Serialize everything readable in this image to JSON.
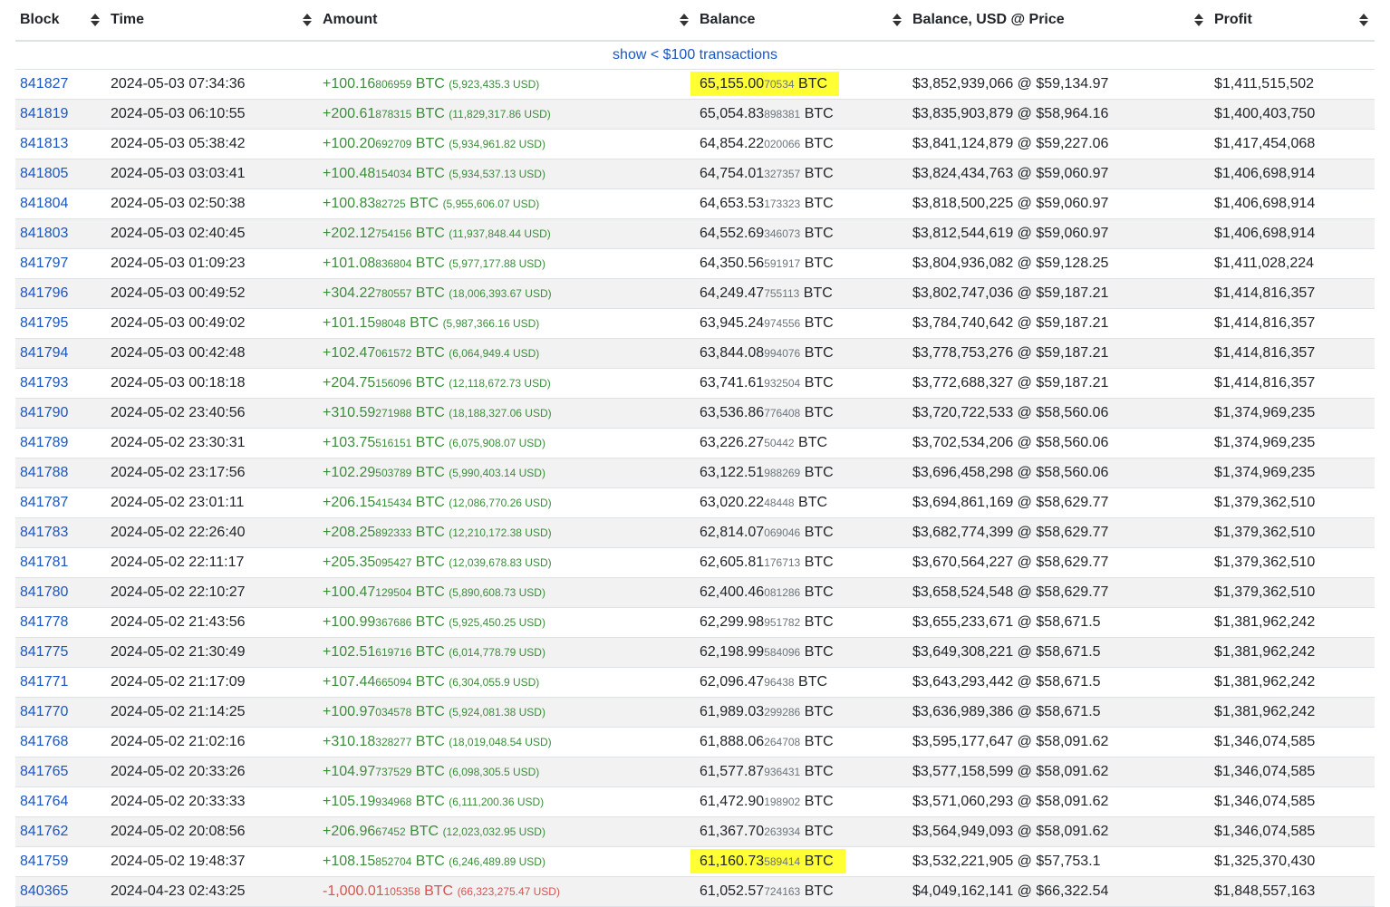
{
  "columns": [
    {
      "key": "block",
      "label": "Block"
    },
    {
      "key": "time",
      "label": "Time"
    },
    {
      "key": "amount",
      "label": "Amount"
    },
    {
      "key": "balance",
      "label": "Balance"
    },
    {
      "key": "usd",
      "label": "Balance, USD @ Price"
    },
    {
      "key": "profit",
      "label": "Profit"
    }
  ],
  "show_small_link": "show < $100 transactions",
  "unit": "BTC",
  "rows": [
    {
      "block": "841827",
      "time": "2024-05-03 07:34:36",
      "amt_main": "+100.16",
      "amt_small": "806959",
      "amt_usd": "(5,923,435.3 USD)",
      "bal_main": "65,155.00",
      "bal_small": "70534",
      "usd": "$3,852,939,066 @ $59,134.97",
      "profit": "$1,411,515,502",
      "type": "pos",
      "highlight": true
    },
    {
      "block": "841819",
      "time": "2024-05-03 06:10:55",
      "amt_main": "+200.61",
      "amt_small": "878315",
      "amt_usd": "(11,829,317.86 USD)",
      "bal_main": "65,054.83",
      "bal_small": "898381",
      "usd": "$3,835,903,879 @ $58,964.16",
      "profit": "$1,400,403,750",
      "type": "pos",
      "highlight": false
    },
    {
      "block": "841813",
      "time": "2024-05-03 05:38:42",
      "amt_main": "+100.20",
      "amt_small": "692709",
      "amt_usd": "(5,934,961.82 USD)",
      "bal_main": "64,854.22",
      "bal_small": "020066",
      "usd": "$3,841,124,879 @ $59,227.06",
      "profit": "$1,417,454,068",
      "type": "pos",
      "highlight": false
    },
    {
      "block": "841805",
      "time": "2024-05-03 03:03:41",
      "amt_main": "+100.48",
      "amt_small": "154034",
      "amt_usd": "(5,934,537.13 USD)",
      "bal_main": "64,754.01",
      "bal_small": "327357",
      "usd": "$3,824,434,763 @ $59,060.97",
      "profit": "$1,406,698,914",
      "type": "pos",
      "highlight": false
    },
    {
      "block": "841804",
      "time": "2024-05-03 02:50:38",
      "amt_main": "+100.83",
      "amt_small": "82725",
      "amt_usd": "(5,955,606.07 USD)",
      "bal_main": "64,653.53",
      "bal_small": "173323",
      "usd": "$3,818,500,225 @ $59,060.97",
      "profit": "$1,406,698,914",
      "type": "pos",
      "highlight": false
    },
    {
      "block": "841803",
      "time": "2024-05-03 02:40:45",
      "amt_main": "+202.12",
      "amt_small": "754156",
      "amt_usd": "(11,937,848.44 USD)",
      "bal_main": "64,552.69",
      "bal_small": "346073",
      "usd": "$3,812,544,619 @ $59,060.97",
      "profit": "$1,406,698,914",
      "type": "pos",
      "highlight": false
    },
    {
      "block": "841797",
      "time": "2024-05-03 01:09:23",
      "amt_main": "+101.08",
      "amt_small": "836804",
      "amt_usd": "(5,977,177.88 USD)",
      "bal_main": "64,350.56",
      "bal_small": "591917",
      "usd": "$3,804,936,082 @ $59,128.25",
      "profit": "$1,411,028,224",
      "type": "pos",
      "highlight": false
    },
    {
      "block": "841796",
      "time": "2024-05-03 00:49:52",
      "amt_main": "+304.22",
      "amt_small": "780557",
      "amt_usd": "(18,006,393.67 USD)",
      "bal_main": "64,249.47",
      "bal_small": "755113",
      "usd": "$3,802,747,036 @ $59,187.21",
      "profit": "$1,414,816,357",
      "type": "pos",
      "highlight": false
    },
    {
      "block": "841795",
      "time": "2024-05-03 00:49:02",
      "amt_main": "+101.15",
      "amt_small": "98048",
      "amt_usd": "(5,987,366.16 USD)",
      "bal_main": "63,945.24",
      "bal_small": "974556",
      "usd": "$3,784,740,642 @ $59,187.21",
      "profit": "$1,414,816,357",
      "type": "pos",
      "highlight": false
    },
    {
      "block": "841794",
      "time": "2024-05-03 00:42:48",
      "amt_main": "+102.47",
      "amt_small": "061572",
      "amt_usd": "(6,064,949.4 USD)",
      "bal_main": "63,844.08",
      "bal_small": "994076",
      "usd": "$3,778,753,276 @ $59,187.21",
      "profit": "$1,414,816,357",
      "type": "pos",
      "highlight": false
    },
    {
      "block": "841793",
      "time": "2024-05-03 00:18:18",
      "amt_main": "+204.75",
      "amt_small": "156096",
      "amt_usd": "(12,118,672.73 USD)",
      "bal_main": "63,741.61",
      "bal_small": "932504",
      "usd": "$3,772,688,327 @ $59,187.21",
      "profit": "$1,414,816,357",
      "type": "pos",
      "highlight": false
    },
    {
      "block": "841790",
      "time": "2024-05-02 23:40:56",
      "amt_main": "+310.59",
      "amt_small": "271988",
      "amt_usd": "(18,188,327.06 USD)",
      "bal_main": "63,536.86",
      "bal_small": "776408",
      "usd": "$3,720,722,533 @ $58,560.06",
      "profit": "$1,374,969,235",
      "type": "pos",
      "highlight": false
    },
    {
      "block": "841789",
      "time": "2024-05-02 23:30:31",
      "amt_main": "+103.75",
      "amt_small": "516151",
      "amt_usd": "(6,075,908.07 USD)",
      "bal_main": "63,226.27",
      "bal_small": "50442",
      "usd": "$3,702,534,206 @ $58,560.06",
      "profit": "$1,374,969,235",
      "type": "pos",
      "highlight": false
    },
    {
      "block": "841788",
      "time": "2024-05-02 23:17:56",
      "amt_main": "+102.29",
      "amt_small": "503789",
      "amt_usd": "(5,990,403.14 USD)",
      "bal_main": "63,122.51",
      "bal_small": "988269",
      "usd": "$3,696,458,298 @ $58,560.06",
      "profit": "$1,374,969,235",
      "type": "pos",
      "highlight": false
    },
    {
      "block": "841787",
      "time": "2024-05-02 23:01:11",
      "amt_main": "+206.15",
      "amt_small": "415434",
      "amt_usd": "(12,086,770.26 USD)",
      "bal_main": "63,020.22",
      "bal_small": "48448",
      "usd": "$3,694,861,169 @ $58,629.77",
      "profit": "$1,379,362,510",
      "type": "pos",
      "highlight": false
    },
    {
      "block": "841783",
      "time": "2024-05-02 22:26:40",
      "amt_main": "+208.25",
      "amt_small": "892333",
      "amt_usd": "(12,210,172.38 USD)",
      "bal_main": "62,814.07",
      "bal_small": "069046",
      "usd": "$3,682,774,399 @ $58,629.77",
      "profit": "$1,379,362,510",
      "type": "pos",
      "highlight": false
    },
    {
      "block": "841781",
      "time": "2024-05-02 22:11:17",
      "amt_main": "+205.35",
      "amt_small": "095427",
      "amt_usd": "(12,039,678.83 USD)",
      "bal_main": "62,605.81",
      "bal_small": "176713",
      "usd": "$3,670,564,227 @ $58,629.77",
      "profit": "$1,379,362,510",
      "type": "pos",
      "highlight": false
    },
    {
      "block": "841780",
      "time": "2024-05-02 22:10:27",
      "amt_main": "+100.47",
      "amt_small": "129504",
      "amt_usd": "(5,890,608.73 USD)",
      "bal_main": "62,400.46",
      "bal_small": "081286",
      "usd": "$3,658,524,548 @ $58,629.77",
      "profit": "$1,379,362,510",
      "type": "pos",
      "highlight": false
    },
    {
      "block": "841778",
      "time": "2024-05-02 21:43:56",
      "amt_main": "+100.99",
      "amt_small": "367686",
      "amt_usd": "(5,925,450.25 USD)",
      "bal_main": "62,299.98",
      "bal_small": "951782",
      "usd": "$3,655,233,671 @ $58,671.5",
      "profit": "$1,381,962,242",
      "type": "pos",
      "highlight": false
    },
    {
      "block": "841775",
      "time": "2024-05-02 21:30:49",
      "amt_main": "+102.51",
      "amt_small": "619716",
      "amt_usd": "(6,014,778.79 USD)",
      "bal_main": "62,198.99",
      "bal_small": "584096",
      "usd": "$3,649,308,221 @ $58,671.5",
      "profit": "$1,381,962,242",
      "type": "pos",
      "highlight": false
    },
    {
      "block": "841771",
      "time": "2024-05-02 21:17:09",
      "amt_main": "+107.44",
      "amt_small": "665094",
      "amt_usd": "(6,304,055.9 USD)",
      "bal_main": "62,096.47",
      "bal_small": "96438",
      "usd": "$3,643,293,442 @ $58,671.5",
      "profit": "$1,381,962,242",
      "type": "pos",
      "highlight": false
    },
    {
      "block": "841770",
      "time": "2024-05-02 21:14:25",
      "amt_main": "+100.97",
      "amt_small": "034578",
      "amt_usd": "(5,924,081.38 USD)",
      "bal_main": "61,989.03",
      "bal_small": "299286",
      "usd": "$3,636,989,386 @ $58,671.5",
      "profit": "$1,381,962,242",
      "type": "pos",
      "highlight": false
    },
    {
      "block": "841768",
      "time": "2024-05-02 21:02:16",
      "amt_main": "+310.18",
      "amt_small": "328277",
      "amt_usd": "(18,019,048.54 USD)",
      "bal_main": "61,888.06",
      "bal_small": "264708",
      "usd": "$3,595,177,647 @ $58,091.62",
      "profit": "$1,346,074,585",
      "type": "pos",
      "highlight": false
    },
    {
      "block": "841765",
      "time": "2024-05-02 20:33:26",
      "amt_main": "+104.97",
      "amt_small": "737529",
      "amt_usd": "(6,098,305.5 USD)",
      "bal_main": "61,577.87",
      "bal_small": "936431",
      "usd": "$3,577,158,599 @ $58,091.62",
      "profit": "$1,346,074,585",
      "type": "pos",
      "highlight": false
    },
    {
      "block": "841764",
      "time": "2024-05-02 20:33:33",
      "amt_main": "+105.19",
      "amt_small": "934968",
      "amt_usd": "(6,111,200.36 USD)",
      "bal_main": "61,472.90",
      "bal_small": "198902",
      "usd": "$3,571,060,293 @ $58,091.62",
      "profit": "$1,346,074,585",
      "type": "pos",
      "highlight": false
    },
    {
      "block": "841762",
      "time": "2024-05-02 20:08:56",
      "amt_main": "+206.96",
      "amt_small": "67452",
      "amt_usd": "(12,023,032.95 USD)",
      "bal_main": "61,367.70",
      "bal_small": "263934",
      "usd": "$3,564,949,093 @ $58,091.62",
      "profit": "$1,346,074,585",
      "type": "pos",
      "highlight": false
    },
    {
      "block": "841759",
      "time": "2024-05-02 19:48:37",
      "amt_main": "+108.15",
      "amt_small": "852704",
      "amt_usd": "(6,246,489.89 USD)",
      "bal_main": "61,160.73",
      "bal_small": "589414",
      "usd": "$3,532,221,905 @ $57,753.1",
      "profit": "$1,325,370,430",
      "type": "pos",
      "highlight": true
    },
    {
      "block": "840365",
      "time": "2024-04-23 02:43:25",
      "amt_main": "-1,000.01",
      "amt_small": "105358",
      "amt_usd": "(66,323,275.47 USD)",
      "bal_main": "61,052.57",
      "bal_small": "724163",
      "usd": "$4,049,162,141 @ $66,322.54",
      "profit": "$1,848,557,163",
      "type": "neg",
      "highlight": false
    }
  ],
  "colors": {
    "link": "#1a56c4",
    "positive": "#3c8c3c",
    "negative": "#d9534f",
    "highlight": "#ffff33",
    "stripe": "#f2f2f2"
  }
}
